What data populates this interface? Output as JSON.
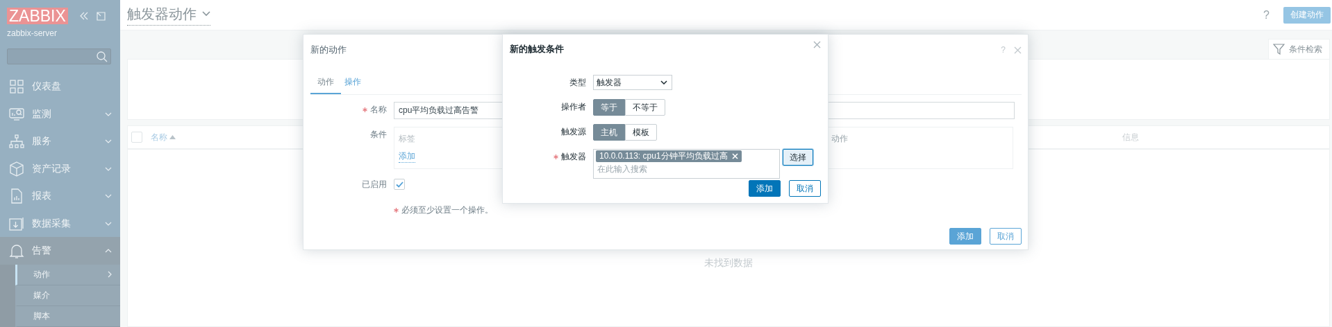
{
  "sidebar": {
    "logo": "ZABBIX",
    "server": "zabbix-server",
    "menu": [
      {
        "label": "仪表盘",
        "kind": "link",
        "expanded": false
      },
      {
        "label": "监测",
        "kind": "menu",
        "expanded": false
      },
      {
        "label": "服务",
        "kind": "menu",
        "expanded": false
      },
      {
        "label": "资产记录",
        "kind": "menu",
        "expanded": false
      },
      {
        "label": "报表",
        "kind": "menu",
        "expanded": false
      },
      {
        "label": "数据采集",
        "kind": "menu",
        "expanded": false
      },
      {
        "label": "告警",
        "kind": "menu",
        "expanded": true,
        "children": [
          {
            "label": "动作",
            "kind": "menu",
            "selected": true
          },
          {
            "label": "媒介",
            "kind": "link",
            "selected": false
          },
          {
            "label": "脚本",
            "kind": "link",
            "selected": false
          }
        ]
      }
    ]
  },
  "header": {
    "title": "触发器动作",
    "help": "?",
    "create_button": "创建动作"
  },
  "filter": {
    "tab_label": "条件检索"
  },
  "table": {
    "select_all_checked": false,
    "columns": [
      {
        "label": "名称",
        "sorted": true
      },
      {
        "label": "信息",
        "sorted": false
      }
    ],
    "empty_text": "未找到数据"
  },
  "action_dialog": {
    "title": "新的动作",
    "help": "?",
    "tabs": [
      {
        "label": "动作",
        "selected": true
      },
      {
        "label": "操作",
        "selected": false
      }
    ],
    "name": {
      "label": "名称",
      "required": true,
      "value": "cpu平均负载过高告警"
    },
    "conditions": {
      "label": "条件",
      "columns": [
        "标签",
        "动作"
      ],
      "add_link": "添加"
    },
    "enabled": {
      "label": "已启用",
      "checked": true
    },
    "note": {
      "text": "必须至少设置一个操作。",
      "required": true
    },
    "buttons": [
      {
        "label": "添加",
        "kind": "primary"
      },
      {
        "label": "取消",
        "kind": "secondary"
      }
    ]
  },
  "condition_dialog": {
    "title": "新的触发条件",
    "type": {
      "label": "类型",
      "value": "触发器",
      "required": false
    },
    "operator": {
      "label": "操作者",
      "required": false,
      "options": [
        {
          "label": "等于",
          "selected": true
        },
        {
          "label": "不等于",
          "selected": false
        }
      ]
    },
    "source": {
      "label": "触发源",
      "required": false,
      "options": [
        {
          "label": "主机",
          "selected": true
        },
        {
          "label": "模板",
          "selected": false
        }
      ]
    },
    "trigger": {
      "label": "触发器",
      "required": true,
      "tags": [
        {
          "label": "10.0.0.113: cpu1分钟平均负载过高"
        }
      ],
      "placeholder": "在此输入搜索",
      "select_button": "选择"
    },
    "buttons": [
      {
        "label": "添加",
        "kind": "primary"
      },
      {
        "label": "取消",
        "kind": "secondary"
      }
    ]
  }
}
